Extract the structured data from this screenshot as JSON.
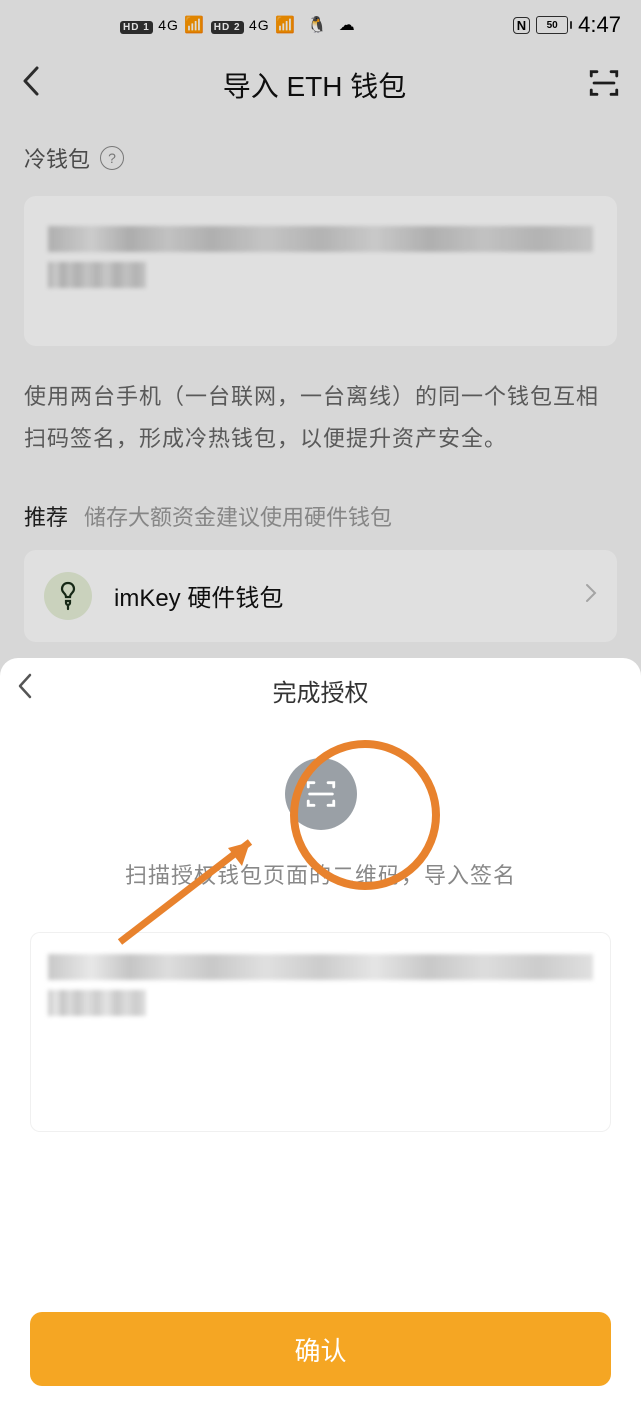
{
  "status": {
    "time": "4:47",
    "battery_pct": "50",
    "carrier_4g": "4G"
  },
  "header": {
    "title": "导入 ETH 钱包"
  },
  "cold_wallet": {
    "label": "冷钱包",
    "desc": "使用两台手机（一台联网，一台离线）的同一个钱包互相扫码签名，形成冷热钱包，以便提升资产安全。"
  },
  "recommend": {
    "label": "推荐",
    "text": "储存大额资金建议使用硬件钱包"
  },
  "imkey": {
    "title": "imKey 硬件钱包"
  },
  "sheet": {
    "title": "完成授权",
    "hint": "扫描授权钱包页面的二维码，导入签名",
    "confirm": "确认"
  }
}
